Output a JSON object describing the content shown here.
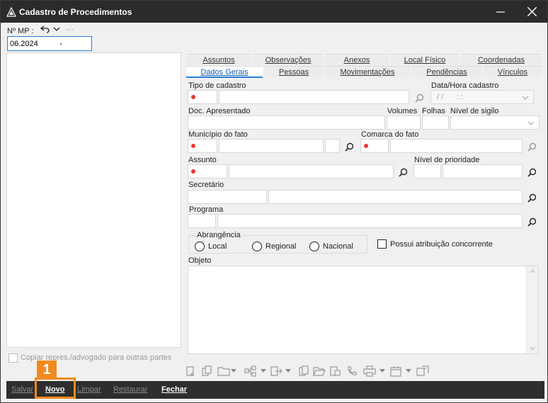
{
  "window": {
    "title": "Cadastro de Procedimentos",
    "minimize_icon": "minimize-icon",
    "close_icon": "close-icon"
  },
  "mp": {
    "label": "Nº MP :",
    "value": "06.2024          -"
  },
  "tabs_row1": [
    {
      "label": "Assuntos"
    },
    {
      "label": "Observações"
    },
    {
      "label": "Anexos"
    },
    {
      "label": "Local Físico"
    },
    {
      "label": "Coordenadas"
    }
  ],
  "tabs_row2": [
    {
      "label": "Dados Gerais",
      "active": true
    },
    {
      "label": "Pessoas"
    },
    {
      "label": "Movimentações"
    },
    {
      "label": "Pendências"
    },
    {
      "label": "Vínculos"
    }
  ],
  "form": {
    "tipo_cadastro": "Tipo de cadastro",
    "data_hora": "Data/Hora cadastro",
    "data_hora_placeholder": "/ /      : :",
    "doc_apresentado": "Doc. Apresentado",
    "volumes": "Volumes",
    "folhas": "Folhas",
    "nivel_sigilo": "Nível de sigilo",
    "municipio": "Município do fato",
    "comarca": "Comarca do fato",
    "assunto": "Assunto",
    "nivel_prioridade": "Nível de prioridade",
    "secretario": "Secretário",
    "programa": "Programa",
    "abrangencia": "Abrangência",
    "radio_local": "Local",
    "radio_regional": "Regional",
    "radio_nacional": "Nacional",
    "possui_atribuicao": "Possui atribuição concorrente",
    "objeto": "Objeto"
  },
  "left": {
    "copiar_label": "Copiar repres./advogado para outras partes"
  },
  "bottom": {
    "salvar": "Salvar",
    "novo": "Novo",
    "limpar": "Limpar",
    "restaurar": "Restaurar",
    "fechar": "Fechar"
  },
  "annotation": {
    "badge": "1"
  },
  "colors": {
    "accent": "#2a7fd4",
    "required": "#e53935",
    "highlight": "#f08a1c"
  }
}
